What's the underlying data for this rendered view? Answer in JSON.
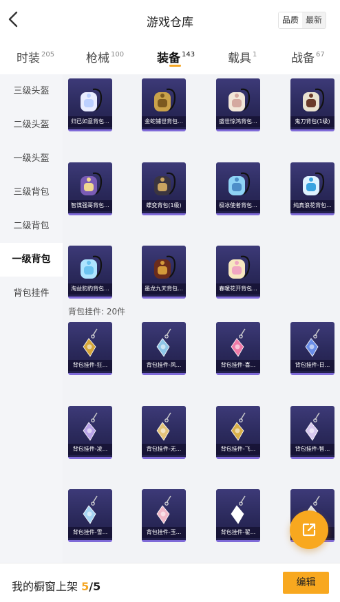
{
  "header": {
    "title": "游戏仓库",
    "sort": [
      "品质",
      "最新"
    ],
    "sort_active": 0
  },
  "tabs": [
    {
      "label": "时装",
      "count": "205"
    },
    {
      "label": "枪械",
      "count": "100"
    },
    {
      "label": "装备",
      "count": "143"
    },
    {
      "label": "载具",
      "count": "1"
    },
    {
      "label": "战备",
      "count": "67"
    }
  ],
  "sidebar": [
    "三级头盔",
    "二级头盔",
    "一级头盔",
    "三级背包",
    "二级背包",
    "一级背包",
    "背包挂件"
  ],
  "sidebar_active": 5,
  "grid_backpacks": [
    {
      "label": "归已如意背包...",
      "icon": "bunny-backpack-icon"
    },
    {
      "label": "金蛇铺世背包...",
      "icon": "golden-snake-backpack-icon"
    },
    {
      "label": "盛世惊鸿背包...",
      "icon": "flower-backpack-icon"
    },
    {
      "label": "鬼刀背包(1级)",
      "icon": "ghost-blade-backpack-icon"
    },
    {
      "label": "智谋强哥背包...",
      "icon": "purple-mask-backpack-icon"
    },
    {
      "label": "蝶变背包(1级)",
      "icon": "black-butterfly-backpack-icon"
    },
    {
      "label": "极冰使者背包...",
      "icon": "ice-backpack-icon"
    },
    {
      "label": "纯真浪花背包...",
      "icon": "drink-cup-backpack-icon"
    },
    {
      "label": "淘益豹豹背包...",
      "icon": "blue-blob-backpack-icon"
    },
    {
      "label": "墨龙九天背包...",
      "icon": "dragon-backpack-icon"
    },
    {
      "label": "春暖花开背包...",
      "icon": "spring-flower-backpack-icon"
    }
  ],
  "section_charm": "背包挂件: 20件",
  "grid_charms": [
    {
      "label": "背包挂件-狂...",
      "icon": "golden-claw-charm-icon"
    },
    {
      "label": "背包挂件-风...",
      "icon": "wind-tag-charm-icon"
    },
    {
      "label": "背包挂件-喜...",
      "icon": "pink-bow-charm-icon"
    },
    {
      "label": "背包挂件-日...",
      "icon": "blue-ring-charm-icon"
    },
    {
      "label": "背包挂件-凌...",
      "icon": "purple-crystal-charm-icon"
    },
    {
      "label": "背包挂件-无...",
      "icon": "gem-charm-icon"
    },
    {
      "label": "背包挂件-飞...",
      "icon": "golden-cross-charm-icon"
    },
    {
      "label": "背包挂件-智...",
      "icon": "star-charm-icon"
    },
    {
      "label": "背包挂件-雪...",
      "icon": "blue-bow-charm-icon"
    },
    {
      "label": "背包挂件-玉...",
      "icon": "rabbit-charm-icon"
    },
    {
      "label": "背包挂件-翟...",
      "icon": "panda-charm-icon"
    },
    {
      "label": "背包挂件-...",
      "icon": "white-charm-icon"
    }
  ],
  "footer": {
    "text": "我的橱窗上架",
    "count": "5",
    "slash": "/",
    "total": "5",
    "edit_label": "编辑"
  },
  "colors": {
    "accent": "#f8a81f",
    "card_dark": "#2b2a5c",
    "card_border": "#7f6ad8"
  }
}
